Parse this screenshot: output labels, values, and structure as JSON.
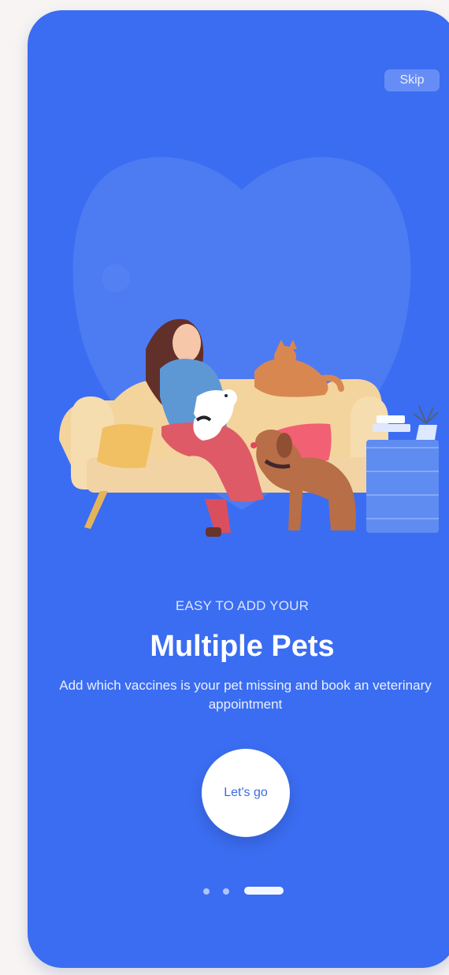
{
  "top_bar": {
    "skip_label": "Skip"
  },
  "onboarding": {
    "eyebrow": "EASY TO ADD YOUR",
    "title": "Multiple Pets",
    "subtitle": "Add which vaccines is your pet missing and book an veterinary appointment",
    "cta_label": "Let's go",
    "pagination": {
      "current": 3,
      "total": 3
    }
  },
  "colors": {
    "background": "#3b6df2",
    "cta_bg": "#ffffff",
    "text": "#ffffff"
  }
}
